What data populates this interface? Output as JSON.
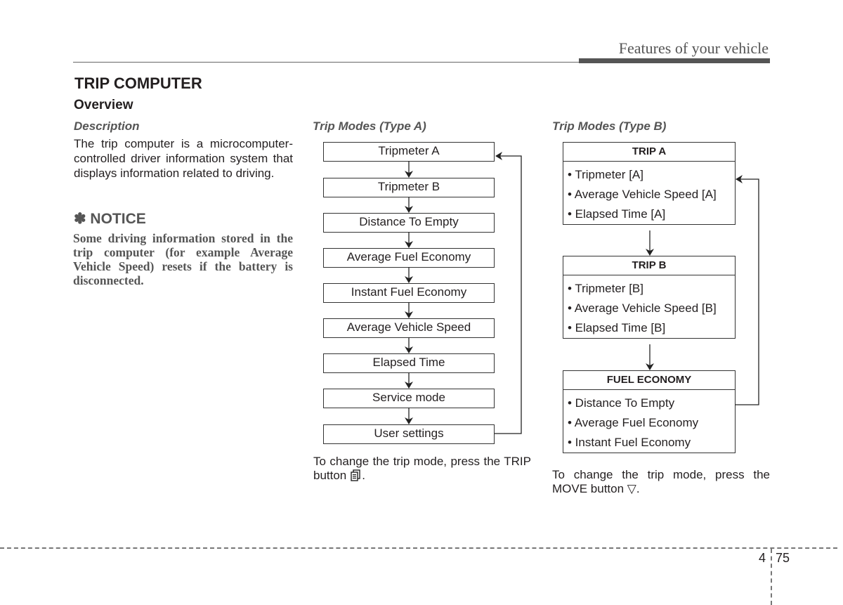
{
  "header": {
    "running_title": "Features of your vehicle"
  },
  "section": {
    "title": "TRIP COMPUTER",
    "subtitle": "Overview",
    "description_heading": "Description",
    "description_body": "The trip computer is a microcomputer-controlled driver information system that displays information related to driving.",
    "notice": {
      "icon": "asterisk-icon",
      "heading": "✽ NOTICE",
      "body": "Some driving information stored in the trip computer (for example Average Vehicle Speed) resets if the battery is disconnected."
    }
  },
  "type_a": {
    "heading": "Trip Modes (Type A)",
    "modes": [
      "Tripmeter A",
      "Tripmeter B",
      "Distance To Empty",
      "Average Fuel Economy",
      "Instant Fuel Economy",
      "Average Vehicle Speed",
      "Elapsed Time",
      "Service mode",
      "User settings"
    ],
    "note_text": "To change the trip mode, press the TRIP button",
    "note_icon": "trip-button-icon",
    "note_end": "."
  },
  "type_b": {
    "heading": "Trip Modes (Type B)",
    "groups": [
      {
        "title": "TRIP A",
        "items": [
          "• Tripmeter [A]",
          "• Average Vehicle Speed [A]",
          "• Elapsed Time [A]"
        ]
      },
      {
        "title": "TRIP B",
        "items": [
          "• Tripmeter [B]",
          "• Average Vehicle Speed [B]",
          "• Elapsed Time [B]"
        ]
      },
      {
        "title": "FUEL ECONOMY",
        "items": [
          "• Distance To Empty",
          "• Average Fuel Economy",
          "• Instant Fuel Economy"
        ]
      }
    ],
    "note_text": "To change the trip mode, press the MOVE button",
    "note_symbol": "▽",
    "note_end": "."
  },
  "footer": {
    "chapter": "4",
    "page": "75"
  }
}
